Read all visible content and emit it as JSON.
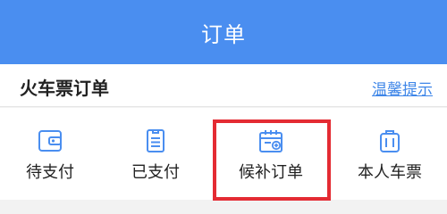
{
  "header": {
    "title": "订单"
  },
  "section": {
    "title": "火车票订单",
    "tips_label": "温馨提示"
  },
  "tabs": [
    {
      "label": "待支付",
      "icon": "wallet-icon"
    },
    {
      "label": "已支付",
      "icon": "receipt-icon"
    },
    {
      "label": "候补订单",
      "icon": "calendar-add-icon"
    },
    {
      "label": "本人车票",
      "icon": "luggage-icon"
    }
  ],
  "highlight": {
    "target": "候补订单",
    "color": "#e42b33"
  },
  "colors": {
    "accent": "#4a8ef0",
    "link": "#3e86e8",
    "icon": "#4a8ef0"
  }
}
